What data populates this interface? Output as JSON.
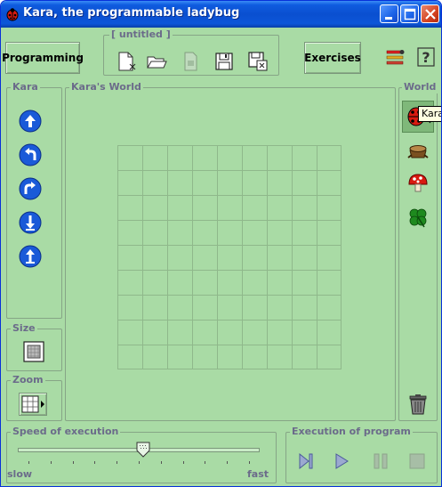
{
  "window": {
    "title": "Kara, the programmable ladybug"
  },
  "toolbar": {
    "programming_label": "Programming",
    "file_group_title": "[ untitled ]",
    "exercises_label": "Exercises"
  },
  "panels": {
    "kara_title": "Kara",
    "world_area_title": "Kara's World",
    "world_palette_title": "World",
    "size_title": "Size",
    "zoom_title": "Zoom",
    "speed_title": "Speed of execution",
    "execution_title": "Execution of program"
  },
  "speed": {
    "slow_label": "slow",
    "fast_label": "fast",
    "level": 0.52
  },
  "tooltip": {
    "text": "Kara"
  },
  "grid": {
    "columns": 9,
    "rows": 9
  },
  "icons": {
    "kara_commands": [
      "move-forward-icon",
      "turn-left-icon",
      "turn-right-icon",
      "put-leaf-icon",
      "remove-leaf-icon"
    ],
    "world_items": [
      "ladybug-icon",
      "tree-stump-icon",
      "mushroom-icon",
      "clover-leaf-icon"
    ],
    "execution": [
      "step-icon",
      "play-icon",
      "pause-icon",
      "stop-icon"
    ]
  },
  "colors": {
    "background": "#a9dba5",
    "titlebar": "#0a4fd0",
    "command_blue": "#1a5ad8",
    "ladybug_red": "#d81a10"
  }
}
